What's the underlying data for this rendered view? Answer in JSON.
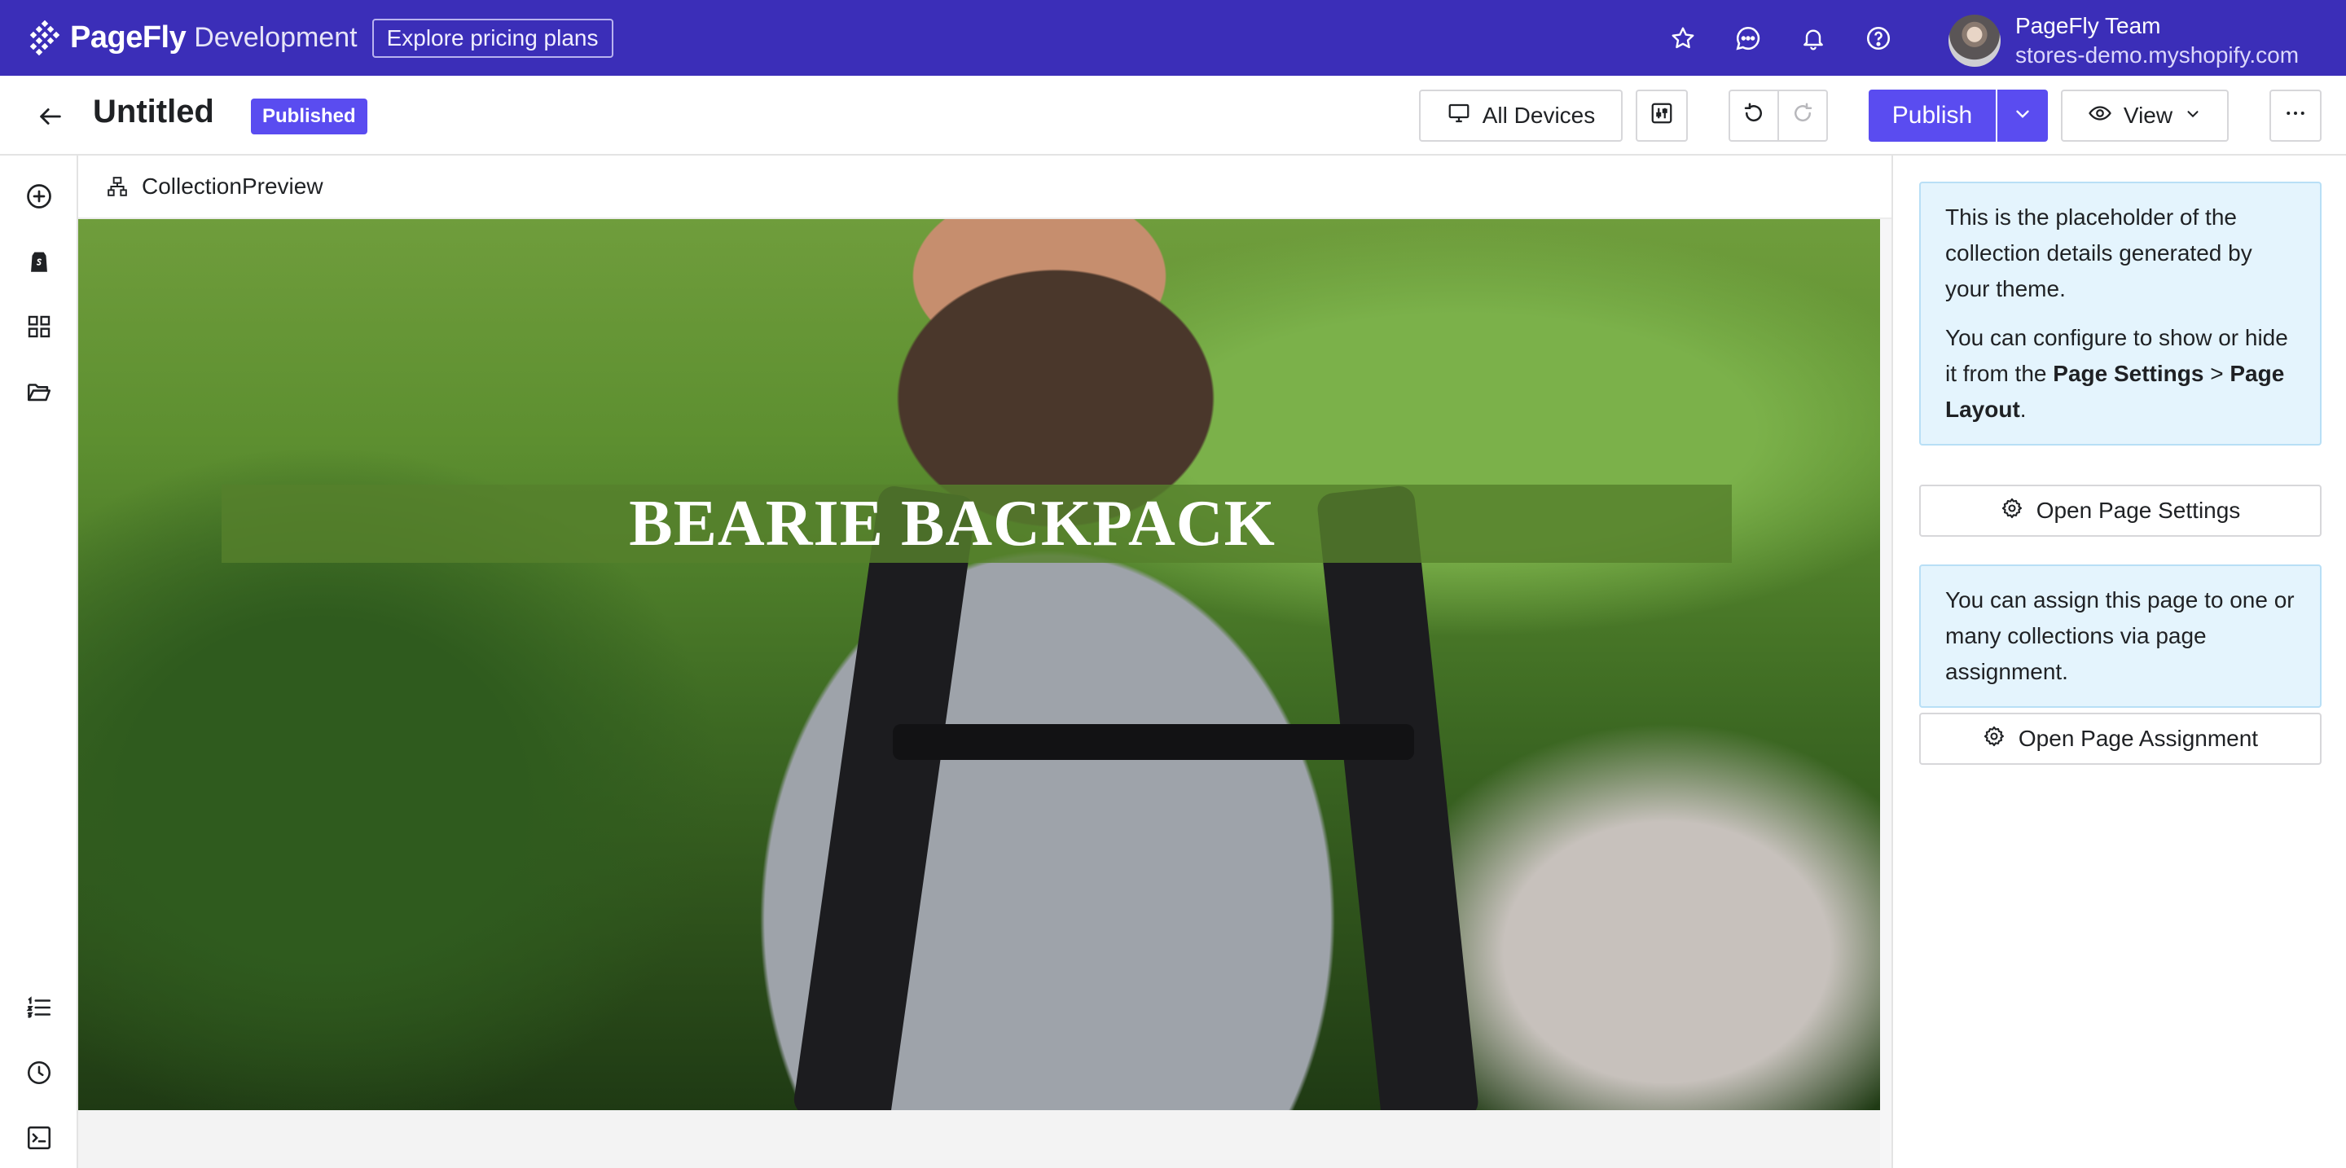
{
  "topbar": {
    "brand_name": "PageFly",
    "brand_env": "Development",
    "pricing_label": "Explore pricing plans",
    "icons": [
      "star-icon",
      "chat-icon",
      "bell-icon",
      "help-icon"
    ],
    "account_name": "PageFly Team",
    "account_store": "stores-demo.myshopify.com"
  },
  "header": {
    "title": "Untitled",
    "status": "Published",
    "devices_label": "All Devices",
    "publish_label": "Publish",
    "view_label": "View"
  },
  "sidebar": {
    "top_icons": [
      "add-icon",
      "shopify-icon",
      "grid-icon",
      "folder-icon"
    ],
    "bottom_icons": [
      "list-icon",
      "history-icon",
      "terminal-icon"
    ]
  },
  "canvas": {
    "breadcrumb": "CollectionPreview",
    "hero_title": "BEARIE BACKPACK"
  },
  "panel": {
    "info1_line": "This is the placeholder of the collection details generated by your theme.",
    "info1_pre": "You can configure to show or hide it from the ",
    "info1_bold1": "Page Settings",
    "info1_sep": " > ",
    "info1_bold2": "Page Layout",
    "info1_post": ".",
    "settings_btn": "Open Page Settings",
    "info2": "You can assign this page to one or many collections via page assignment.",
    "assign_btn": "Open Page Assignment"
  },
  "colors": {
    "topbar_bg": "#3b2eb8",
    "accent": "#5a4cf0",
    "info_bg": "#e4f4fd"
  }
}
